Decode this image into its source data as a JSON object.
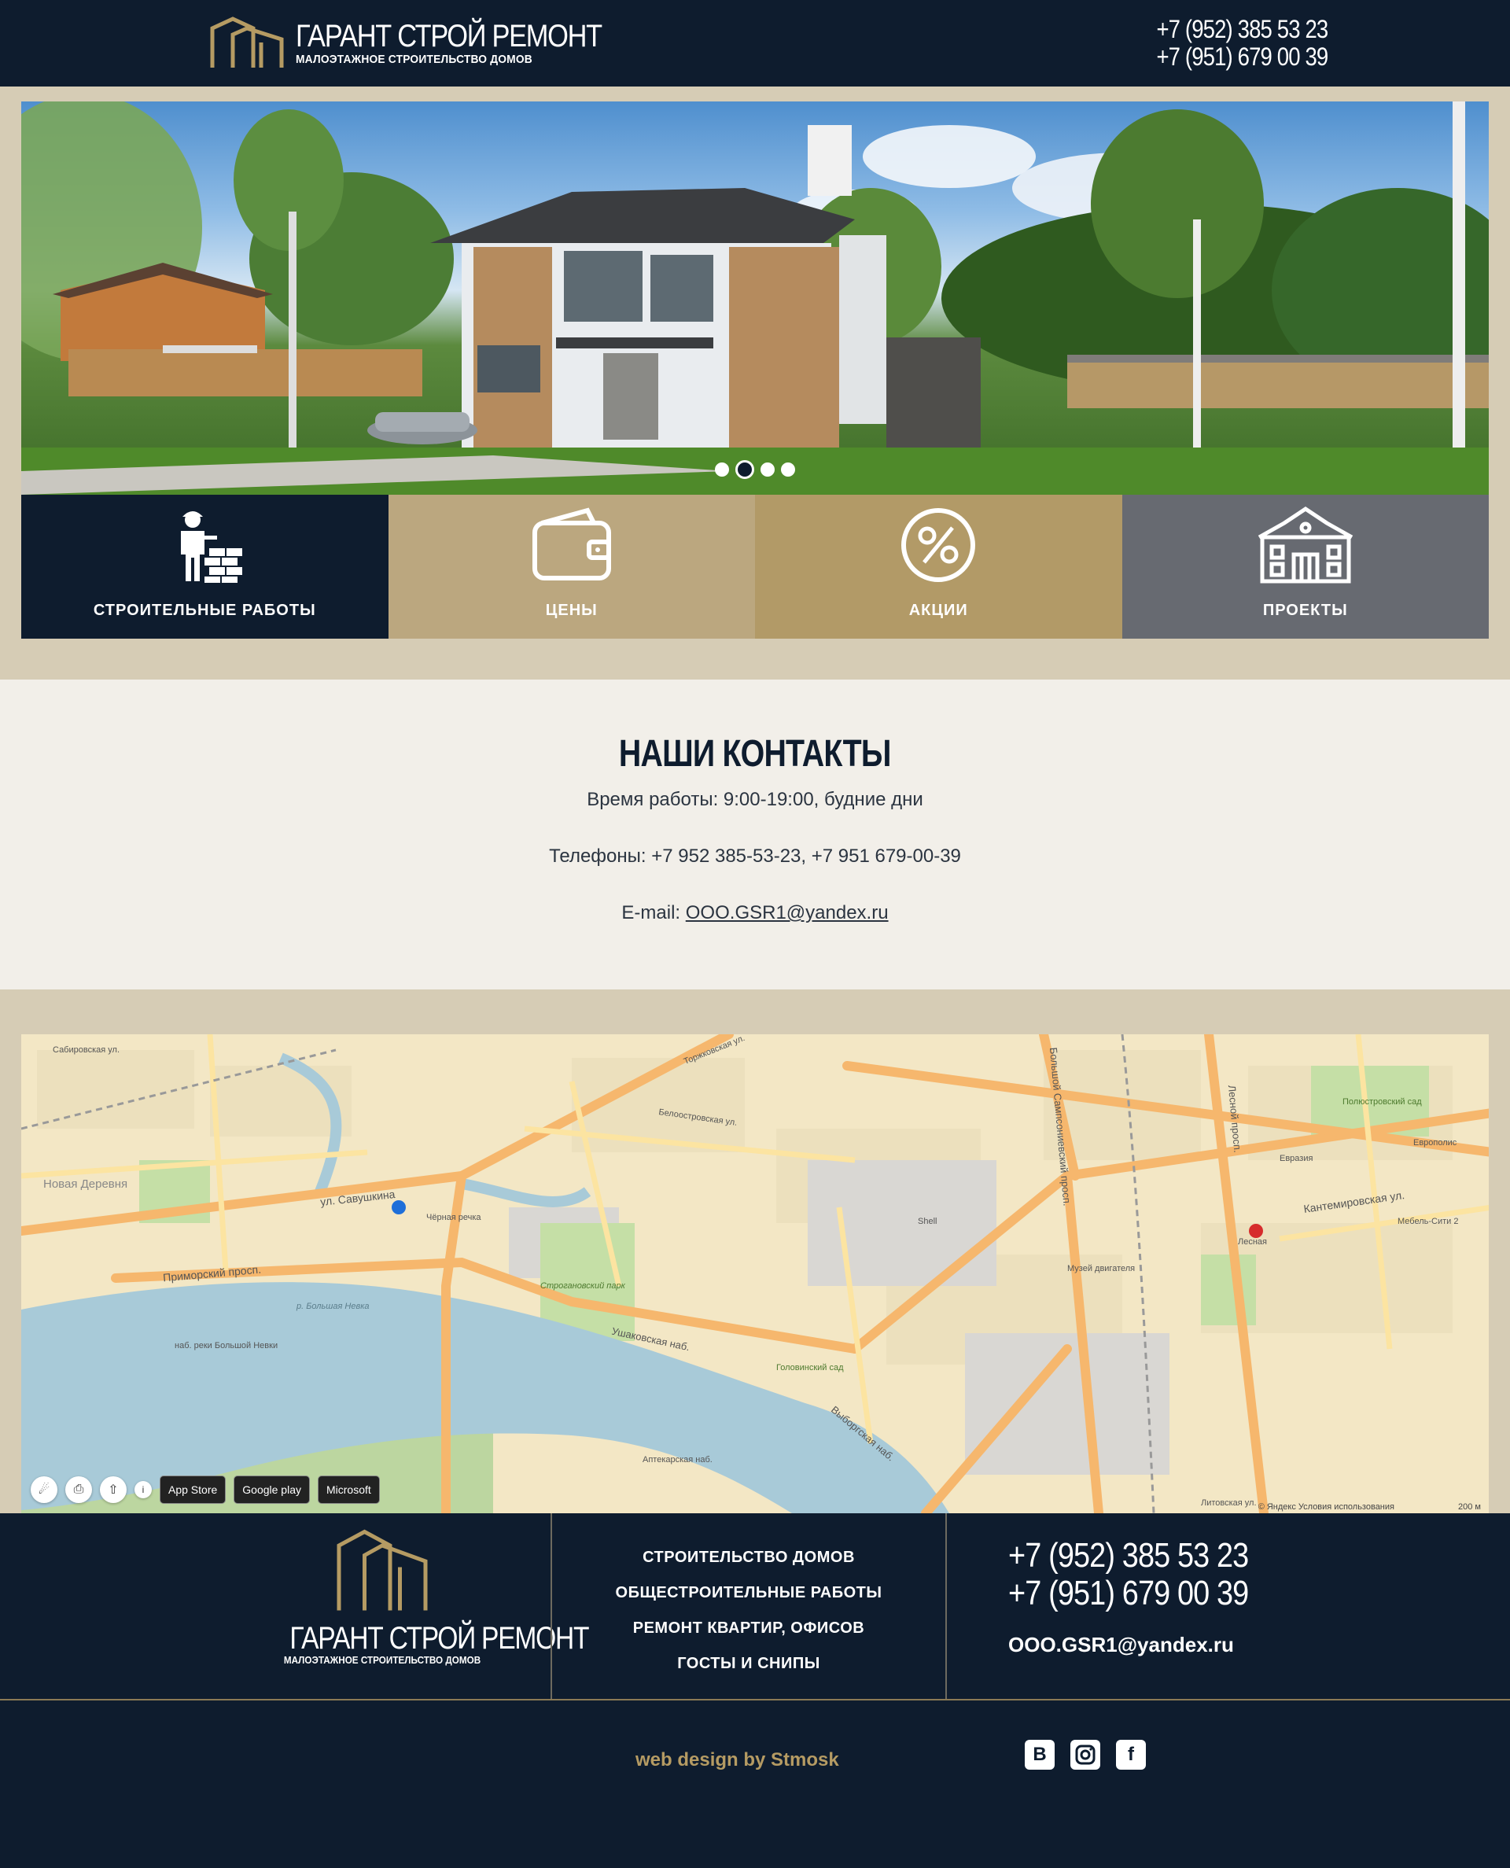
{
  "header": {
    "logo_title": "ГАРАНТ СТРОЙ РЕМОНТ",
    "logo_subtitle": "МАЛОЭТАЖНОЕ СТРОИТЕЛЬСТВО ДОМОВ",
    "phone1": "+7 (952) 385 53 23",
    "phone2": "+7 (951) 679 00 39"
  },
  "slider": {
    "slides": 4,
    "active_slide": 2
  },
  "tiles": [
    {
      "label": "СТРОИТЕЛЬНЫЕ РАБОТЫ",
      "color": "#0e1c2e",
      "icon": "builder-icon"
    },
    {
      "label": "ЦЕНЫ",
      "color": "#bba77f",
      "icon": "wallet-icon"
    },
    {
      "label": "АКЦИИ",
      "color": "#b29a67",
      "icon": "percent-icon"
    },
    {
      "label": "ПРОЕКТЫ",
      "color": "#676a71",
      "icon": "building-icon"
    }
  ],
  "contacts": {
    "title": "НАШИ КОНТАКТЫ",
    "hours": "Время работы: 9:00-19:00, будние дни",
    "phones": "Телефоны: +7 952 385-53-23, +7 951 679-00-39",
    "email_label": "E-mail: ",
    "email": "OOO.GSR1@yandex.ru"
  },
  "map": {
    "labels": [
      "Сабировская ул.",
      "Торжковская ул.",
      "Новая Деревня",
      "ул. Савушкина",
      "Чёрная речка",
      "Приморский просп.",
      "Строгановский парк",
      "Ушаковская наб.",
      "Выборгская наб.",
      "Белоостровская ул.",
      "Кантемировская ул.",
      "Лесная",
      "Лесной просп.",
      "Большой Сампсониевский просп.",
      "р. Большая Невка",
      "наб. реки Большой Невки",
      "Аптекарская наб.",
      "Литовская ул.",
      "Европолис",
      "Евразия",
      "Полюстровский сад",
      "Мебель-Сити 2",
      "Музей двигателя",
      "Shell",
      "Головинский сад"
    ],
    "badges": [
      "App Store",
      "Google play",
      "Microsoft"
    ],
    "copyright": "© Яндекс Условия использования",
    "scale": "200 м"
  },
  "footer": {
    "logo_title": "ГАРАНТ СТРОЙ РЕМОНТ",
    "logo_subtitle": "МАЛОЭТАЖНОЕ СТРОИТЕЛЬСТВО ДОМОВ",
    "menu": [
      "СТРОИТЕЛЬСТВО ДОМОВ",
      "ОБЩЕСТРОИТЕЛЬНЫЕ РАБОТЫ",
      "РЕМОНТ КВАРТИР, ОФИСОВ",
      "ГОСТЫ И СНИПЫ"
    ],
    "phone1": "+7 (952) 385 53 23",
    "phone2": "+7 (951) 679 00 39",
    "email": "OOO.GSR1@yandex.ru",
    "credit": "web design by Stmosk",
    "social": [
      "vk-icon",
      "instagram-icon",
      "facebook-icon"
    ]
  },
  "colors": {
    "navy": "#0e1c2e",
    "beige": "#d6ccb5",
    "gold": "#b59b63",
    "light": "#f2efe9"
  }
}
